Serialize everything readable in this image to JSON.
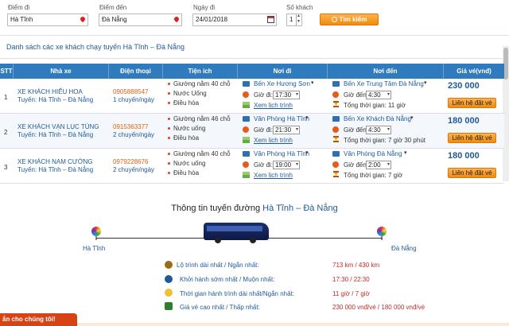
{
  "search": {
    "from_label": "Điểm đi",
    "from_value": "Hà Tĩnh",
    "to_label": "Điểm đến",
    "to_value": "Đà Nẵng",
    "date_label": "Ngày đi",
    "date_value": "24/01/2018",
    "seats_label": "Số khách",
    "seats_value": "1",
    "button_label": "Tìm kiếm"
  },
  "list_title": "Danh sách các xe khách chạy tuyến Hà Tĩnh – Đà Nẵng",
  "table": {
    "headers": [
      "STT",
      "Nhà xe",
      "Điện thoại",
      "Tiện ích",
      "Nơi đi",
      "Nơi đến",
      "Giá vé(vnđ)"
    ],
    "rows": [
      {
        "stt": "1",
        "name": "XE KHÁCH HIẾU HOA",
        "route": "Tuyến: Hà Tĩnh – Đà Nẵng",
        "phone": "0905888547",
        "trips": "1 chuyến/ngày",
        "amenities": [
          "Giường nằm 40 chỗ",
          "Nước Uống",
          "Điều hòa"
        ],
        "from_place": "Bến Xe Hương Sơn",
        "depart_label": "Giờ đi:",
        "depart_time": "17:30",
        "map_link": "Xem lịch trình",
        "to_place": "Bến Xe Trung Tâm Đà Nẵng",
        "arrive_label": "Giờ đến:",
        "arrive_time": "4:30",
        "duration": "Tổng thời gian: 11 giờ",
        "price": "230 000",
        "book_label": "Liên hệ đặt vé"
      },
      {
        "stt": "2",
        "name": "XE KHÁCH VẠN LỤC TÙNG",
        "route": "Tuyến: Hà Tĩnh – Đà Nẵng",
        "phone": "0915363377",
        "trips": "2 chuyến/ngày",
        "amenities": [
          "Giường nằm 46 chỗ",
          "Nước uống",
          "Điều hòa"
        ],
        "from_place": "Văn Phòng Hà Tĩnh",
        "depart_label": "Giờ đi:",
        "depart_time": "21:30",
        "map_link": "Xem lịch trình",
        "to_place": "Bến Xe Khách Đà Nẵng",
        "arrive_label": "Giờ đến:",
        "arrive_time": "4:30",
        "duration": "Tổng thời gian: 7 giờ 30 phút",
        "price": "180 000",
        "book_label": "Liên hệ đặt vé"
      },
      {
        "stt": "3",
        "name": "XE KHÁCH NAM CƯỜNG",
        "route": "Tuyến: Hà Tĩnh – Đà Nẵng",
        "phone": "0979228676",
        "trips": "2 chuyến/ngày",
        "amenities": [
          "Giường nằm 40 chỗ",
          "Nước uống",
          "Điều hòa"
        ],
        "from_place": "Văn Phòng Hà Tĩnh",
        "depart_label": "Giờ đi:",
        "depart_time": "19:00",
        "map_link": "Xem lịch trình",
        "to_place": "Văn Phòng Đà Nẵng",
        "arrive_label": "Giờ đến:",
        "arrive_time": "2:00",
        "duration": "Tổng thời gian: 7 giờ",
        "price": "180 000",
        "book_label": "Liên hệ đặt vé"
      }
    ]
  },
  "route_info": {
    "title_prefix": "Thông tin tuyến đường",
    "title_route": "Hà Tĩnh – Đà Nẵng",
    "origin": "Hà Tĩnh",
    "destination": "Đà Nẵng",
    "stats": [
      {
        "label": "Lộ trình dài nhất / Ngắn nhất:",
        "value": "713 km / 430 km"
      },
      {
        "label": "Khởi hành sớm nhất / Muộn nhất:",
        "value": "17:30 / 22:30"
      },
      {
        "label": "Thời gian hành trình dài nhất/Ngắn nhất:",
        "value": "11 giờ / 7 giờ"
      },
      {
        "label": "Giá vé cao nhất / Thấp nhất:",
        "value": "230 000 vnđ/vé / 180 000 vnđ/vé"
      }
    ]
  },
  "chat_label": "ắn cho chúng tôi!",
  "colors": {
    "accent": "#2f7bbd",
    "button": "#f08a10",
    "link": "#1f5a96",
    "phone": "#e06010"
  }
}
